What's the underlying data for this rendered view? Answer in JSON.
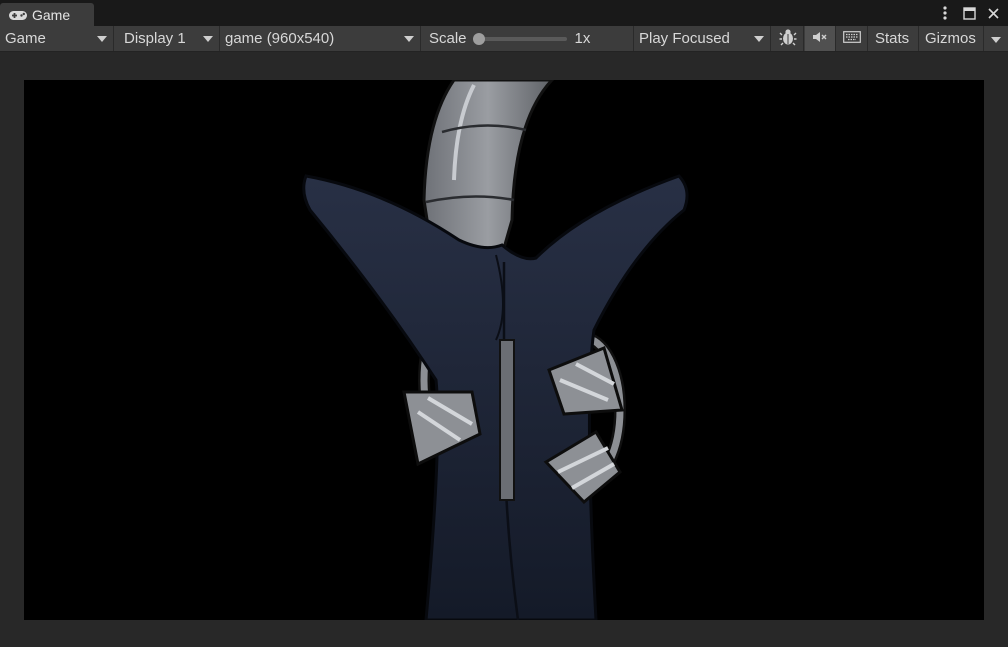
{
  "tab": {
    "title": "Game",
    "icon": "gamepad-icon"
  },
  "tab_actions": {
    "more_icon": "kebab-menu-icon",
    "maximize_icon": "maximize-icon",
    "more_dropdown_icon": "chevron-down-icon"
  },
  "toolbar": {
    "view_select": "Game",
    "display_select": "Display 1",
    "resolution_select": "game (960x540)",
    "scale_label": "Scale",
    "scale_value": "1x",
    "scale_level": 0.0,
    "play_mode_select": "Play Focused",
    "bug_icon": "bug-icon",
    "mute_icon": "mute-audio-icon",
    "keyboard_icon": "keyboard-shortcuts-icon",
    "stats_label": "Stats",
    "gizmos_label": "Gizmos"
  },
  "colors": {
    "editor_bg": "#282828",
    "toolbar_bg": "#3c3c3c",
    "viewport_bg": "#000000",
    "robe": "#232a3c",
    "metal": "#8a8d92"
  }
}
